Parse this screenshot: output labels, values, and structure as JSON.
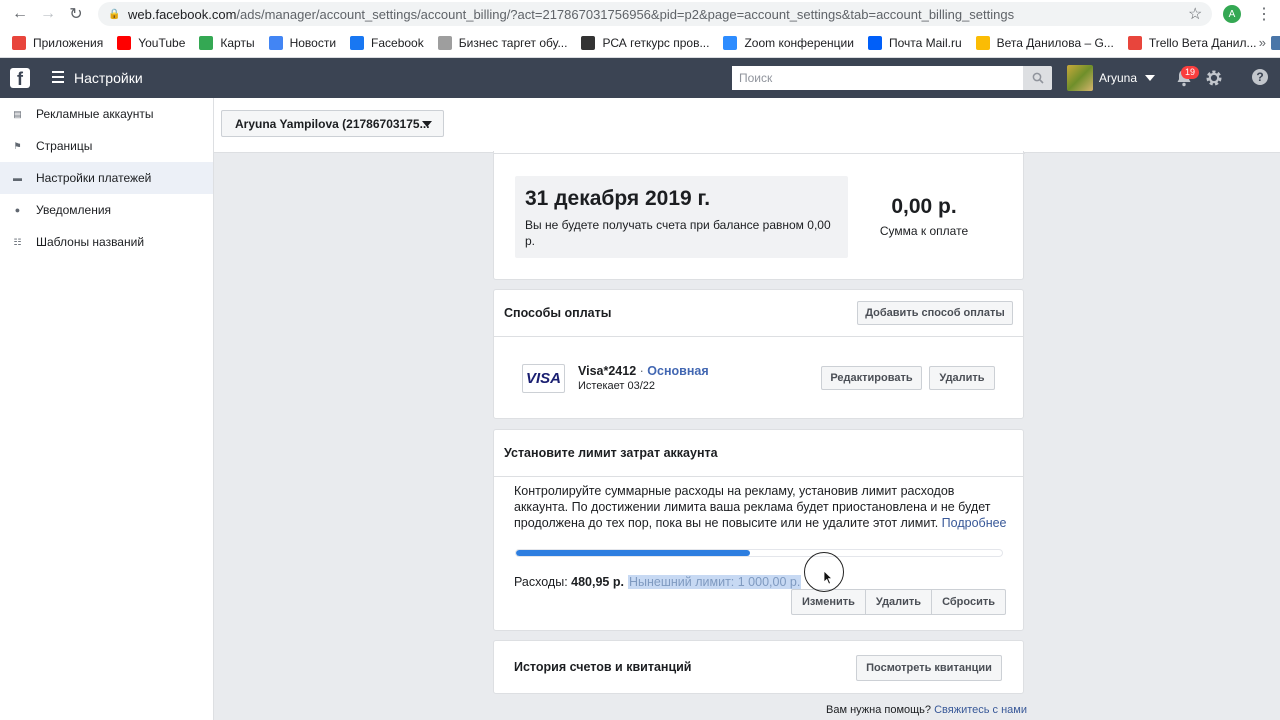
{
  "browser": {
    "url_host": "web.facebook.com",
    "url_path": "/ads/manager/account_settings/account_billing/?act=217867031756956&pid=p2&page=account_settings&tab=account_billing_settings",
    "profile_letter": "A",
    "bookmarks": [
      {
        "label": "Приложения",
        "color": "#e8453c"
      },
      {
        "label": "YouTube",
        "color": "#ff0000"
      },
      {
        "label": "Карты",
        "color": "#34a853"
      },
      {
        "label": "Новости",
        "color": "#4285f4"
      },
      {
        "label": "Facebook",
        "color": "#1877f2"
      },
      {
        "label": "Бизнес таргет обу...",
        "color": "#9e9e9e"
      },
      {
        "label": "РСА геткурс пров...",
        "color": "#333333"
      },
      {
        "label": "Zoom конференции",
        "color": "#2d8cff"
      },
      {
        "label": "Почта Mail.ru",
        "color": "#005ff9"
      },
      {
        "label": "Вета Данилова – G...",
        "color": "#fbbc04"
      },
      {
        "label": "Trello Вета Данил...",
        "color": "#e8453c"
      },
      {
        "label": "VK",
        "color": "#4a76a8"
      }
    ],
    "more": "»"
  },
  "topbar": {
    "logo": "f",
    "title": "Настройки",
    "search_placeholder": "Поиск",
    "user_name": "Aryuna",
    "notif_count": "19",
    "help": "?"
  },
  "sidebar": {
    "items": [
      {
        "label": "Рекламные аккаунты",
        "icon": "ad-accounts-icon",
        "active": false
      },
      {
        "label": "Страницы",
        "icon": "flag-icon",
        "active": false
      },
      {
        "label": "Настройки платежей",
        "icon": "credit-card-icon",
        "active": true
      },
      {
        "label": "Уведомления",
        "icon": "globe-icon",
        "active": false
      },
      {
        "label": "Шаблоны названий",
        "icon": "templates-icon",
        "active": false
      }
    ]
  },
  "account_selector": {
    "value": "Aryuna Yampilova (21786703175..."
  },
  "billing_summary": {
    "date": "31 декабря 2019 г.",
    "note": "Вы не будете получать счета при балансе равном 0,00 р.",
    "amount": "0,00 р.",
    "amount_label": "Сумма к оплате"
  },
  "payment_methods": {
    "title": "Способы оплаты",
    "add_button": "Добавить способ оплаты",
    "card": {
      "logo": "VISA",
      "name": "Visa*2412",
      "separator": " · ",
      "status": "Основная",
      "expires": "Истекает 03/22"
    },
    "edit_button": "Редактировать",
    "delete_button": "Удалить"
  },
  "spending_limit": {
    "title": "Установите лимит затрат аккаунта",
    "description": "Контролируйте суммарные расходы на рекламу, установив лимит расходов аккаунта. По достижении лимита ваша реклама будет приостановлена и не будет продолжена до тех пор, пока вы не повысите или не удалите этот лимит.",
    "learn_more": "Подробнее",
    "progress_fraction": 0.481,
    "progress_color": "#2d7ee0",
    "spent_label": "Расходы:",
    "spent_value": "480,95 р.",
    "current_limit": "Нынешний лимит: 1 000,00 р.",
    "change_button": "Изменить",
    "delete_button": "Удалить",
    "reset_button": "Сбросить"
  },
  "history": {
    "title": "История счетов и квитанций",
    "view_button": "Посмотреть квитанции"
  },
  "footer": {
    "help_text": "Вам нужна помощь?",
    "contact_link": "Свяжитесь с нами"
  }
}
